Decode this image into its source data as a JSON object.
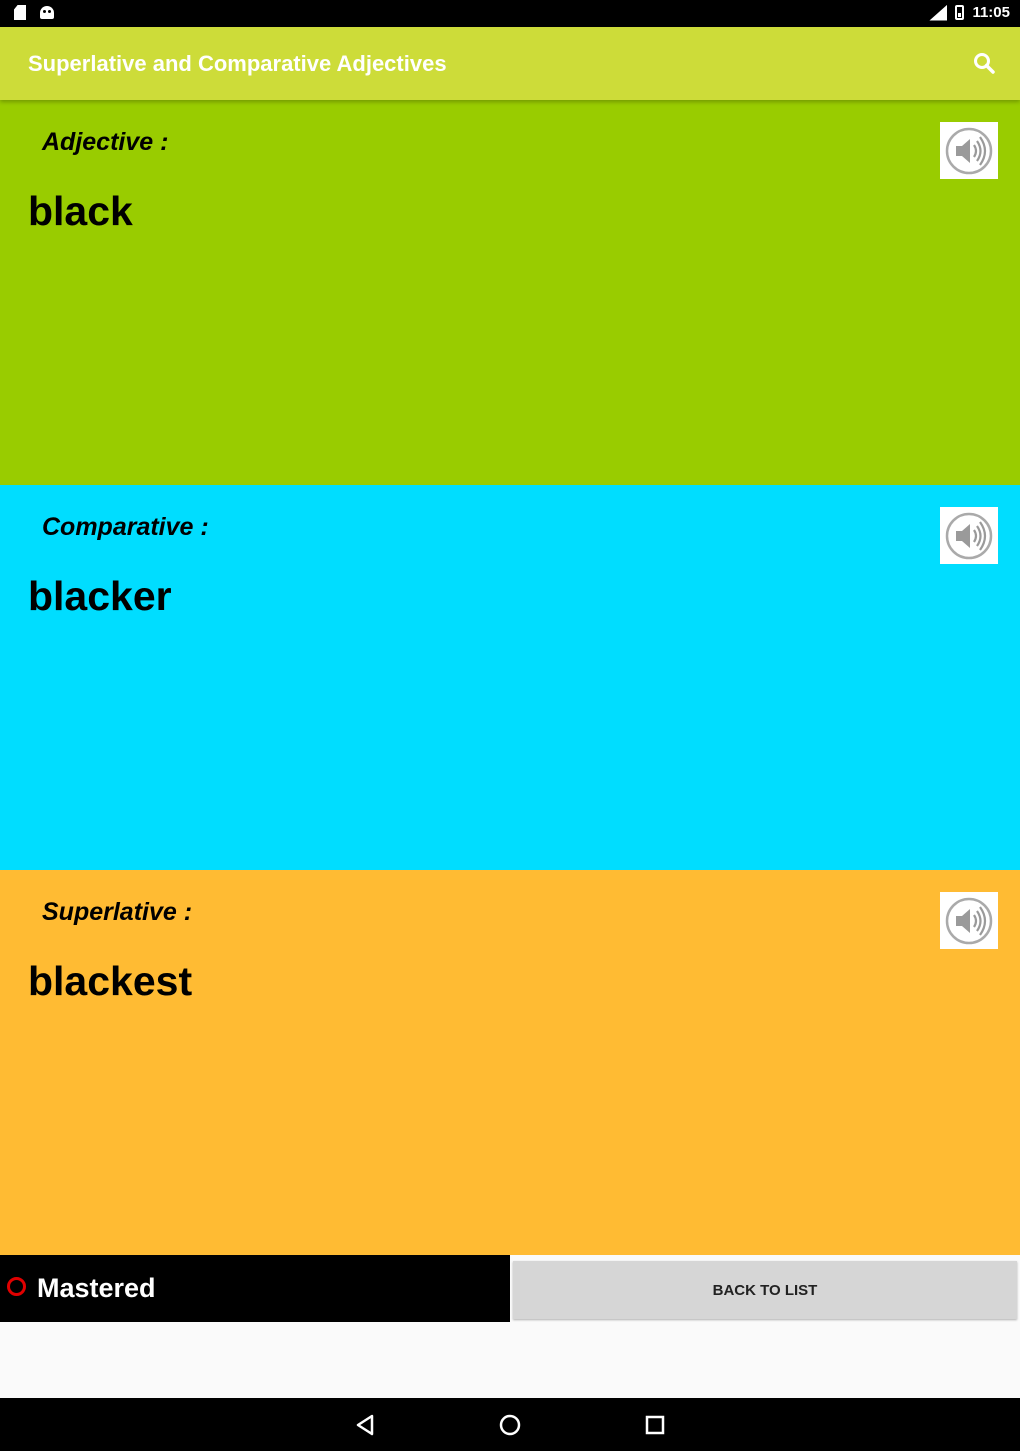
{
  "status_bar": {
    "time": "11:05"
  },
  "app_bar": {
    "title": "Superlative and Comparative Adjectives",
    "search_icon": "search-icon"
  },
  "sections": [
    {
      "label": "Adjective :",
      "word": "black",
      "color": "#99cc00"
    },
    {
      "label": "Comparative :",
      "word": "blacker",
      "color": "#00ddff"
    },
    {
      "label": "Superlative :",
      "word": "blackest",
      "color": "#ffbb33"
    }
  ],
  "controls": {
    "mastered_label": "Mastered",
    "back_label": "BACK TO LIST",
    "radio_color": "#e00000"
  },
  "colors": {
    "app_bar": "#cddc39"
  }
}
